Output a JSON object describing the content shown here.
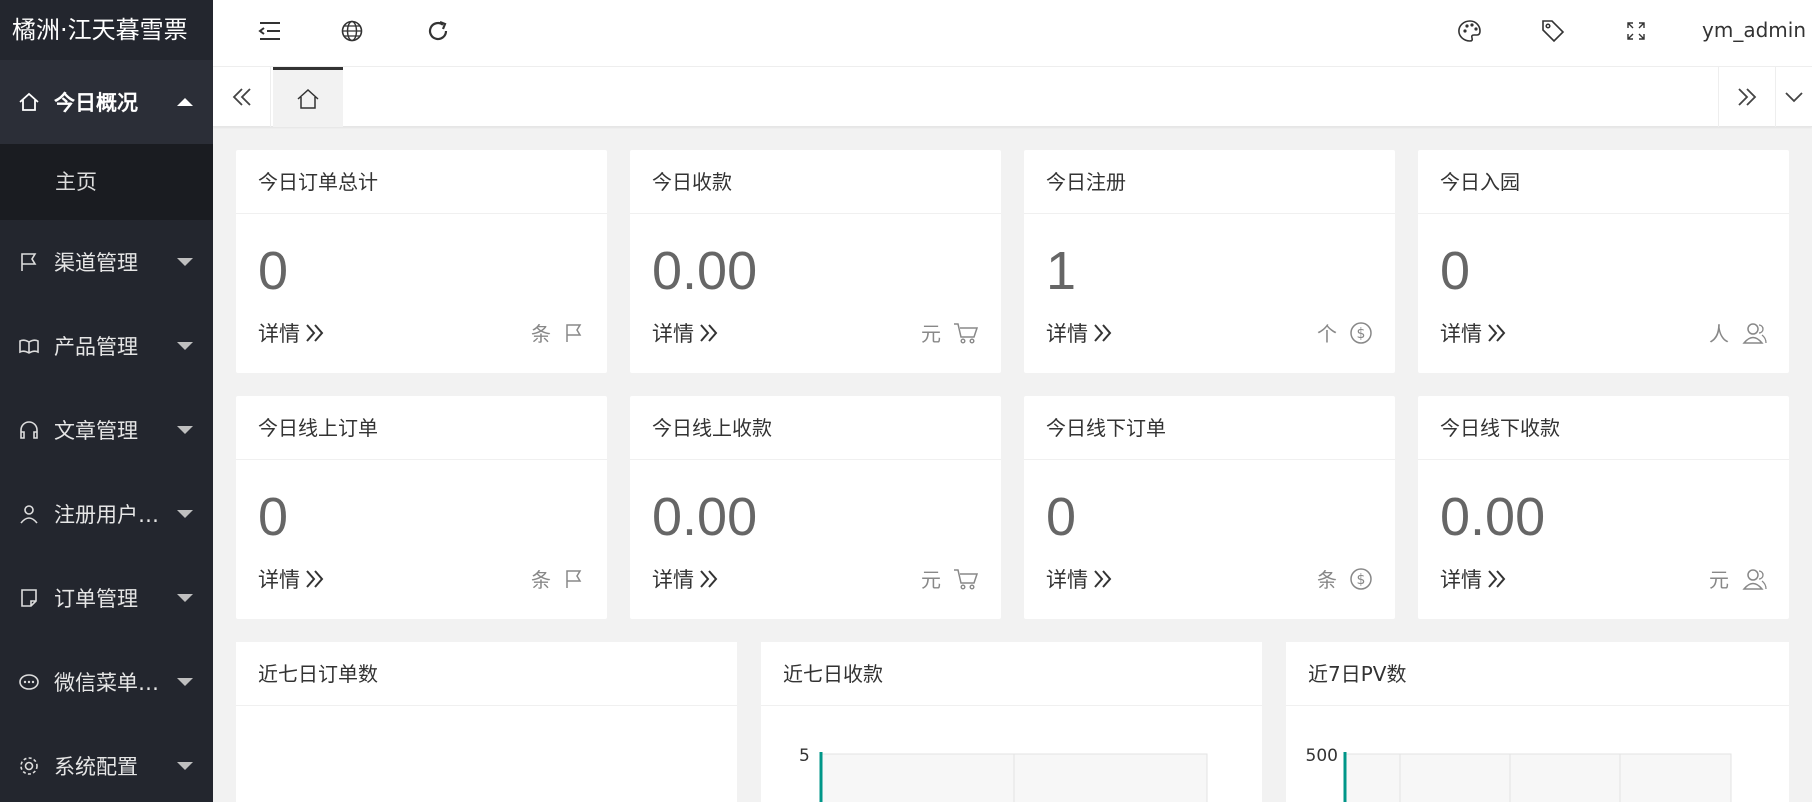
{
  "brand": "橘洲·江天暮雪票",
  "sidebar": {
    "items": [
      {
        "label": "今日概况",
        "icon": "home-icon",
        "expanded": true,
        "children": [
          {
            "label": "主页"
          }
        ]
      },
      {
        "label": "渠道管理",
        "icon": "flag-icon"
      },
      {
        "label": "产品管理",
        "icon": "book-icon"
      },
      {
        "label": "文章管理",
        "icon": "headset-icon"
      },
      {
        "label": "注册用户…",
        "icon": "user-icon"
      },
      {
        "label": "订单管理",
        "icon": "note-icon"
      },
      {
        "label": "微信菜单…",
        "icon": "chat-icon"
      },
      {
        "label": "系统配置",
        "icon": "gear-icon"
      }
    ]
  },
  "header": {
    "user": "ym_admin"
  },
  "stats": [
    {
      "title": "今日订单总计",
      "value": "0",
      "detail": "详情",
      "unit": "条",
      "icon": "flag-icon"
    },
    {
      "title": "今日收款",
      "value": "0.00",
      "detail": "详情",
      "unit": "元",
      "icon": "cart-icon"
    },
    {
      "title": "今日注册",
      "value": "1",
      "detail": "详情",
      "unit": "个",
      "icon": "dollar-icon"
    },
    {
      "title": "今日入园",
      "value": "0",
      "detail": "详情",
      "unit": "人",
      "icon": "users-icon"
    },
    {
      "title": "今日线上订单",
      "value": "0",
      "detail": "详情",
      "unit": "条",
      "icon": "flag-icon"
    },
    {
      "title": "今日线上收款",
      "value": "0.00",
      "detail": "详情",
      "unit": "元",
      "icon": "cart-icon"
    },
    {
      "title": "今日线下订单",
      "value": "0",
      "detail": "详情",
      "unit": "条",
      "icon": "dollar-icon"
    },
    {
      "title": "今日线下收款",
      "value": "0.00",
      "detail": "详情",
      "unit": "元",
      "icon": "users-icon"
    }
  ],
  "charts": [
    {
      "title": "近七日订单数"
    },
    {
      "title": "近七日收款",
      "top_tick": "5"
    },
    {
      "title": "近7日PV数",
      "top_tick": "500"
    }
  ],
  "colors": {
    "sidebar_bg": "#23262e",
    "accent": "#009688"
  }
}
